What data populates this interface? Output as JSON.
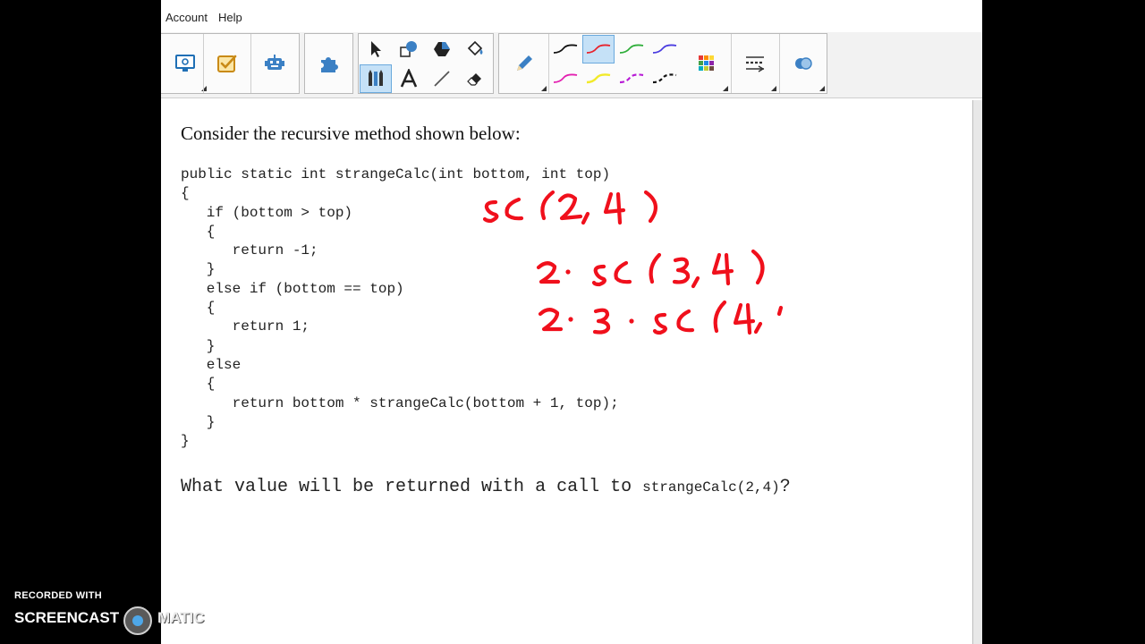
{
  "menu": {
    "account": "Account",
    "help": "Help"
  },
  "toolbar": {
    "pen_colors": [
      "#111111",
      "#e8222b",
      "#2fae3a",
      "#4a3ce0",
      "#e31fb0",
      "#f2ea2a",
      "#b81bd6",
      "#111111"
    ],
    "selected_pen_index": 1,
    "selected_tool": "select-and-pens"
  },
  "content": {
    "prompt": "Consider the recursive method shown below:",
    "code": [
      "public static int strangeCalc(int bottom, int top)",
      "{",
      "   if (bottom > top)",
      "   {",
      "      return -1;",
      "   }",
      "   else if (bottom == top)",
      "   {",
      "      return 1;",
      "   }",
      "   else",
      "   {",
      "      return bottom * strangeCalc(bottom + 1, top);",
      "   }",
      "}"
    ],
    "question_before": "What value will be returned with a call to ",
    "question_call": "strangeCalc(2,4)",
    "question_after": "?"
  },
  "ink": {
    "color": "#f0101c",
    "lines": [
      "sc(2,4)",
      "2·sc(3,4)",
      "2·3·sc(4,"
    ]
  },
  "watermark": {
    "top": "RECORDED WITH",
    "left": "SCREENCAST",
    "right": "MATIC"
  }
}
